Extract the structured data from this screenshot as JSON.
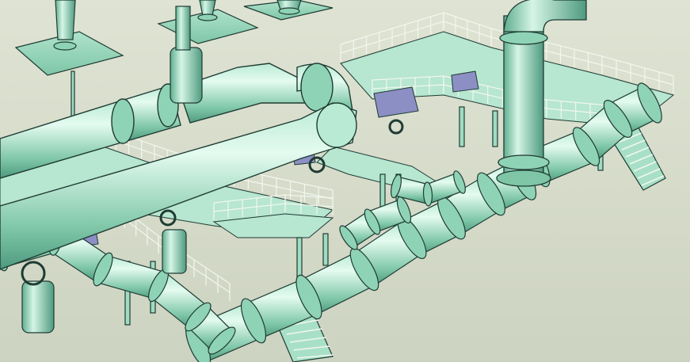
{
  "scene": {
    "subject": "3d-piping-model",
    "colors": {
      "background_top": "#dfe3d3",
      "background_bottom": "#cdd3c1",
      "pipe_light": "#c9f0df",
      "pipe_mid": "#8fd3b6",
      "pipe_dark": "#4e9a7f",
      "outline": "#1f3b33",
      "rail": "#f2f7ee",
      "blue_box": "#8c8fc4"
    }
  }
}
